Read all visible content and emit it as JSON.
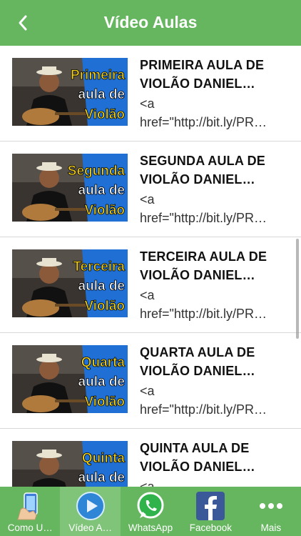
{
  "header": {
    "title": "Vídeo Aulas",
    "back_icon": "chevron-left-icon"
  },
  "videos": [
    {
      "title": "PRIMEIRA AULA DE VIOLÃO DANIEL…",
      "desc": "<a\nhref=\"http://bit.ly/PR…",
      "thumb": {
        "line1": "Primeira",
        "line2": "aula de",
        "line3": "Violão"
      }
    },
    {
      "title": "SEGUNDA AULA DE VIOLÃO DANIEL…",
      "desc": "<a\nhref=\"http://bit.ly/PR…",
      "thumb": {
        "line1": "Segunda",
        "line2": "aula de",
        "line3": "Violão"
      }
    },
    {
      "title": "TERCEIRA AULA DE VIOLÃO DANIEL…",
      "desc": "<a\nhref=\"http://bit.ly/PR…",
      "thumb": {
        "line1": "Terceira",
        "line2": "aula de",
        "line3": "Violão"
      }
    },
    {
      "title": "QUARTA AULA DE VIOLÃO DANIEL…",
      "desc": "<a\nhref=\"http://bit.ly/PR…",
      "thumb": {
        "line1": "Quarta",
        "line2": "aula de",
        "line3": "Violão"
      }
    },
    {
      "title": "QUINTA AULA DE VIOLÃO DANIEL…",
      "desc": "<a",
      "thumb": {
        "line1": "Quinta",
        "line2": "aula de",
        "line3": ""
      }
    }
  ],
  "tabs": [
    {
      "label": "Como U…",
      "icon": "hand-phone-icon",
      "active": false
    },
    {
      "label": "Vídeo A…",
      "icon": "play-icon",
      "active": true
    },
    {
      "label": "WhatsApp",
      "icon": "whatsapp-icon",
      "active": false
    },
    {
      "label": "Facebook",
      "icon": "facebook-icon",
      "active": false
    },
    {
      "label": "Mais",
      "icon": "more-icon",
      "active": false
    }
  ],
  "colors": {
    "brand": "#65b65f",
    "thumb_yellow": "#f5d11a",
    "thumb_blue": "#1f6fd4"
  }
}
